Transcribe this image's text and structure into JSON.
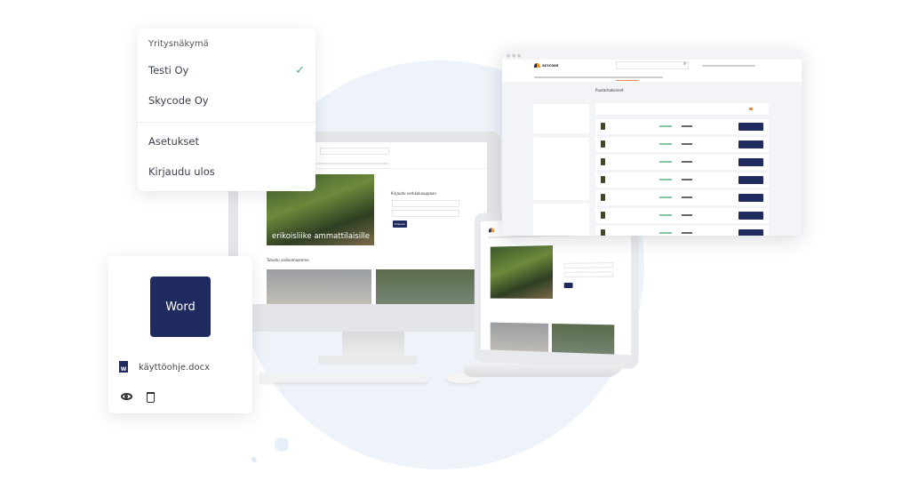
{
  "company_menu": {
    "header": "Yritysnäkymä",
    "companies": [
      {
        "label": "Testi Oy",
        "selected": true
      },
      {
        "label": "Skycode Oy",
        "selected": false
      }
    ],
    "settings_label": "Asetukset",
    "logout_label": "Kirjaudu ulos",
    "check_color": "#48b37a"
  },
  "file_card": {
    "badge": "Word",
    "badge_color": "#1f2a5e",
    "file_name": "käyttöohje.docx",
    "file_icon": "word-file-icon",
    "actions": [
      "eye-icon",
      "trash-icon"
    ]
  },
  "storefront": {
    "logo": "SKYCODE",
    "hero_text": "erikoisliike ammattilaisille",
    "login_title": "Kirjaudu verkkokauppaan",
    "login_button": "Kirjaudu",
    "section_title": "Tutustu valikoimaamme"
  },
  "shop_window": {
    "logo": "SKYCODE",
    "page_title": "Puutarhakoneet",
    "accent_color": "#f08a4b",
    "button_color": "#1f2a5e"
  }
}
